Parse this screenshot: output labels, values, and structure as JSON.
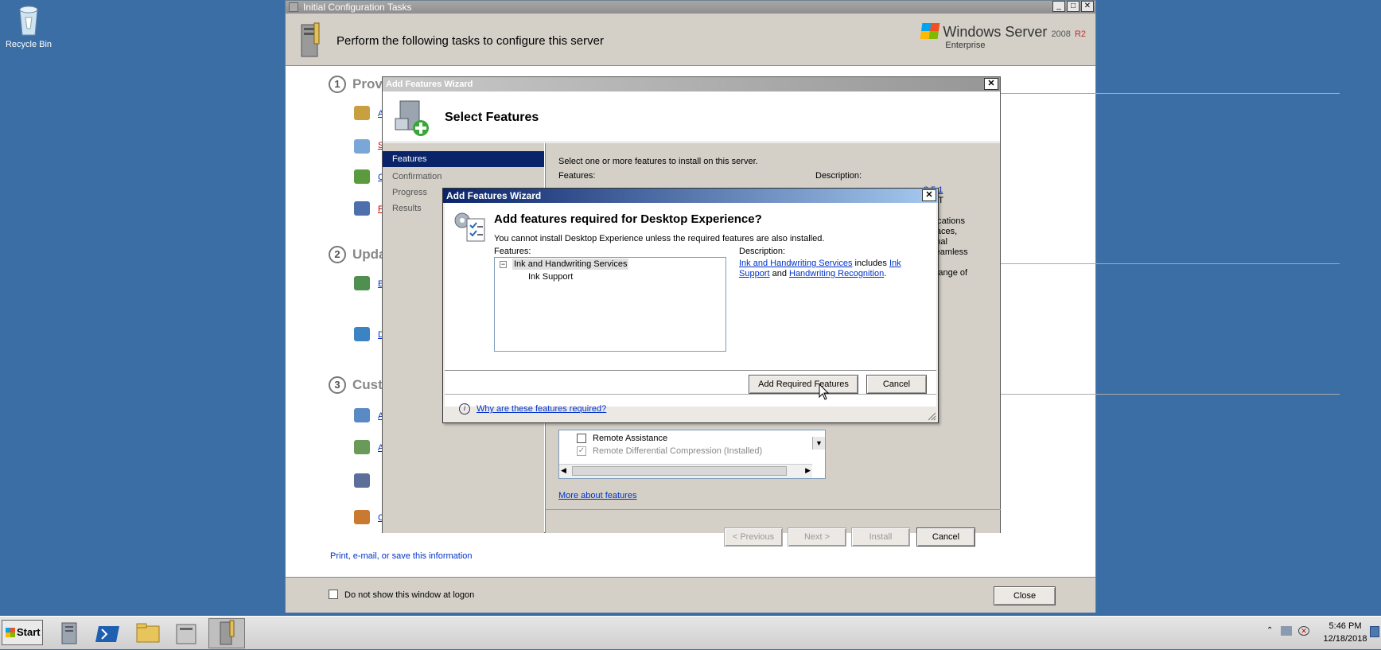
{
  "desktop": {
    "recycle_bin_label": "Recycle Bin"
  },
  "ict_window": {
    "title": "Initial Configuration Tasks",
    "header": "Perform the following tasks to configure this server",
    "brand_main": "Windows Server",
    "brand_version": "2008",
    "brand_r2": "R2",
    "brand_edition": "Enterprise",
    "sections": [
      {
        "num": "1",
        "title": "Prov"
      },
      {
        "num": "2",
        "title": "Upda"
      },
      {
        "num": "3",
        "title": "Cust"
      }
    ],
    "partial_items": [
      "A",
      "S",
      "C",
      "F",
      "E",
      "D",
      "A",
      "A",
      "",
      "C"
    ],
    "print_link": "Print, e-mail, or save this information",
    "dont_show_label": "Do not show this window at logon",
    "close_label": "Close"
  },
  "wizard": {
    "title": "Add Features Wizard",
    "heading": "Select Features",
    "nav": [
      "Features",
      "Confirmation",
      "Progress",
      "Results"
    ],
    "instructions": "Select one or more features to install on this server.",
    "features_label": "Features:",
    "description_label": "Description:",
    "desc_partial": [
      "3.5.1",
      ".NET",
      "ew",
      "pplications",
      "terfaces,",
      "rsonal",
      "e seamless",
      "and",
      "l a range of"
    ],
    "list_items": [
      {
        "label": "Remote Assistance",
        "checked": false
      },
      {
        "label": "Remote Differential Compression  (Installed)",
        "checked": true
      }
    ],
    "more_link": "More about features",
    "prev_label": "< Previous",
    "next_label": "Next >",
    "install_label": "Install",
    "cancel_label": "Cancel"
  },
  "modal": {
    "title": "Add Features Wizard",
    "heading": "Add features required for Desktop Experience?",
    "message": "You cannot install Desktop Experience unless the required features are also installed.",
    "features_label": "Features:",
    "description_label": "Description:",
    "tree": {
      "parent": "Ink and Handwriting Services",
      "child": "Ink Support"
    },
    "desc": {
      "link1": "Ink and Handwriting Services",
      "text1": " includes ",
      "link2": "Ink",
      "link2b": "Support",
      "text2": " and ",
      "link3": "Handwriting Recognition",
      "text3": "."
    },
    "add_label": "Add Required Features",
    "cancel_label": "Cancel",
    "why_link": "Why are these features required?"
  },
  "taskbar": {
    "start_label": "Start",
    "time": "5:46 PM",
    "date": "12/18/2018"
  }
}
